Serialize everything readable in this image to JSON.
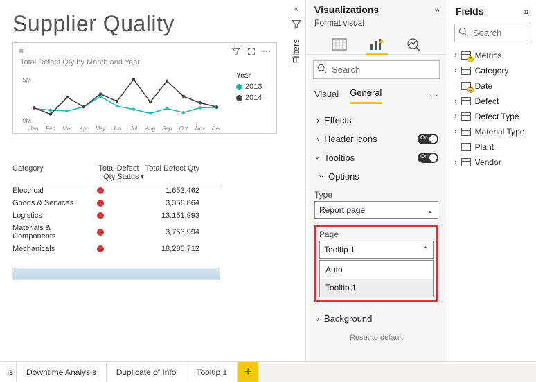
{
  "report": {
    "title": "Supplier Quality"
  },
  "chart": {
    "title": "Total Defect Qty by Month and Year",
    "legend_title": "Year",
    "series_labels": [
      "2013",
      "2014"
    ],
    "colors": {
      "s2013": "#1fbfa8",
      "s2014": "#464646"
    }
  },
  "chart_data": {
    "type": "line",
    "xlabel": "",
    "ylabel": "",
    "categories": [
      "Jan",
      "Feb",
      "Mar",
      "Apr",
      "May",
      "Jun",
      "Jul",
      "Aug",
      "Sep",
      "Oct",
      "Nov",
      "Dec"
    ],
    "ylim": [
      0,
      6000000
    ],
    "yticks": [
      "0M",
      "5M"
    ],
    "series": [
      {
        "name": "2013",
        "color": "#1fbfa8",
        "values": [
          1500000,
          1300000,
          1200000,
          1700000,
          3000000,
          1800000,
          1400000,
          900000,
          1500000,
          1000000,
          1600000,
          1600000
        ]
      },
      {
        "name": "2014",
        "color": "#464646",
        "values": [
          1600000,
          800000,
          2900000,
          1700000,
          3300000,
          2400000,
          5100000,
          2300000,
          4900000,
          3000000,
          2200000,
          1700000
        ]
      }
    ]
  },
  "table": {
    "headers": {
      "c1": "Category",
      "c2": "Total Defect Qty Status",
      "c3": "Total Defect Qty"
    },
    "rows": [
      {
        "category": "Electrical",
        "qty": "1,653,462"
      },
      {
        "category": "Goods & Services",
        "qty": "3,356,864"
      },
      {
        "category": "Logistics",
        "qty": "13,151,993"
      },
      {
        "category": "Materials & Components",
        "qty": "3,753,994"
      },
      {
        "category": "Mechanicals",
        "qty": "18,285,712"
      }
    ]
  },
  "page_tabs": {
    "cut_label": "is",
    "tabs": [
      "Downtime Analysis",
      "Duplicate of Info",
      "Tooltip 1"
    ],
    "add": "+"
  },
  "filters_rail": {
    "label": "Filters"
  },
  "viz": {
    "title": "Visualizations",
    "subtitle": "Format visual",
    "search_placeholder": "Search",
    "tabs": {
      "visual": "Visual",
      "general": "General"
    },
    "sections": {
      "effects": "Effects",
      "header_icons": "Header icons",
      "tooltips": "Tooltips",
      "options": "Options",
      "background": "Background",
      "reset": "Reset to default",
      "on": "On"
    },
    "options": {
      "type_label": "Type",
      "type_value": "Report page",
      "page_label": "Page",
      "page_value": "Tooltip 1",
      "choices": [
        "Auto",
        "Tooltip 1"
      ]
    }
  },
  "fields": {
    "title": "Fields",
    "search_placeholder": "Search",
    "items": [
      {
        "label": "Metrics",
        "sum": true
      },
      {
        "label": "Category",
        "sum": false
      },
      {
        "label": "Date",
        "sum": true
      },
      {
        "label": "Defect",
        "sum": false
      },
      {
        "label": "Defect Type",
        "sum": false
      },
      {
        "label": "Material Type",
        "sum": false
      },
      {
        "label": "Plant",
        "sum": false
      },
      {
        "label": "Vendor",
        "sum": false
      }
    ]
  }
}
